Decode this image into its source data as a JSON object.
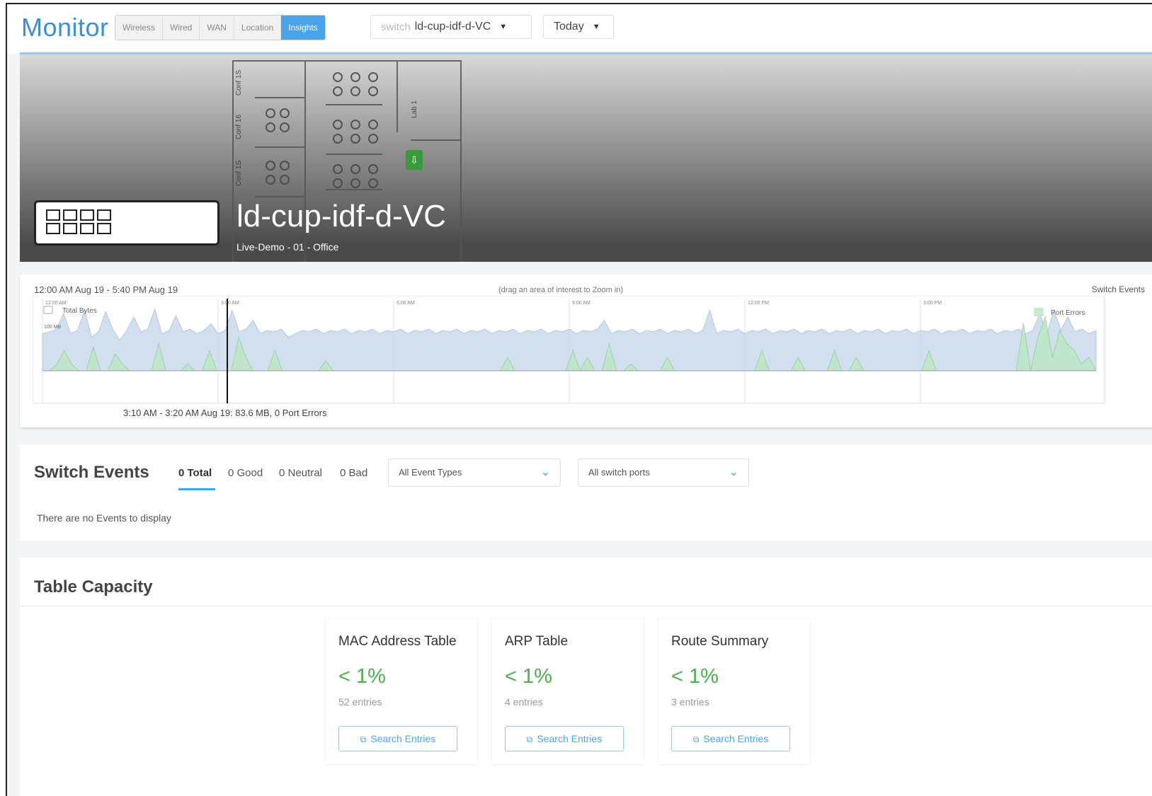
{
  "header": {
    "title": "Monitor",
    "tabs": [
      {
        "label": "Wireless",
        "active": false
      },
      {
        "label": "Wired",
        "active": false
      },
      {
        "label": "WAN",
        "active": false
      },
      {
        "label": "Location",
        "active": false
      },
      {
        "label": "Insights",
        "active": true
      }
    ],
    "switch_dropdown": {
      "prefix": "switch",
      "value": "ld-cup-idf-d-VC"
    },
    "date_dropdown": {
      "value": "Today"
    }
  },
  "hero": {
    "device_name": "ld-cup-idf-d-VC",
    "location": "Live-Demo - 01 - Office",
    "room_labels": [
      "Conf 1S",
      "Conf 16",
      "Conf 1S",
      "Lab 1"
    ]
  },
  "timeline": {
    "range": "12:00 AM Aug 19 - 5:40 PM Aug 19",
    "hint": "(drag an area of interest to Zoom in)",
    "right_label": "Switch Events",
    "hover_readout": "3:10 AM - 3:20 AM Aug 19: 83.6 MB, 0 Port Errors"
  },
  "chart_data": {
    "type": "area",
    "x": [
      "12:00 AM",
      "3:00 AM",
      "6:00 AM",
      "9:00 AM",
      "12:00 PM",
      "3:00 PM"
    ],
    "series": [
      {
        "name": "Total Bytes",
        "color": "#c9d9ec"
      },
      {
        "name": "Port Errors",
        "color": "#bde5c5"
      }
    ],
    "y_tick_labels": [
      "100 MB"
    ],
    "selected_interval": "3:10 AM - 3:20 AM Aug 19",
    "selected_total_bytes_mb": 83.6,
    "selected_port_errors": 0,
    "bytes_profile": [
      0.55,
      0.58,
      0.62,
      0.85,
      0.55,
      0.6,
      0.9,
      0.5,
      0.58,
      0.88,
      0.62,
      0.45,
      0.6,
      0.8,
      0.58,
      0.62,
      0.92,
      0.55,
      0.6,
      0.82,
      0.58,
      0.62,
      0.55,
      0.6,
      0.7,
      0.55,
      0.6,
      0.9,
      0.58,
      0.62,
      0.75,
      0.55,
      0.6,
      0.58,
      0.62,
      0.5,
      0.55,
      0.6,
      0.58,
      0.62,
      0.55,
      0.6,
      0.58,
      0.62,
      0.55,
      0.6,
      0.58,
      0.62,
      0.55,
      0.6,
      0.58,
      0.62,
      0.55,
      0.6,
      0.58,
      0.62,
      0.55,
      0.6,
      0.58,
      0.62,
      0.55,
      0.6,
      0.58,
      0.62,
      0.55,
      0.6,
      0.58,
      0.62,
      0.55,
      0.6,
      0.58,
      0.62,
      0.55,
      0.6,
      0.58,
      0.62,
      0.55,
      0.6,
      0.58,
      0.62,
      0.75,
      0.55,
      0.6,
      0.58,
      0.62,
      0.55,
      0.6,
      0.58,
      0.62,
      0.55,
      0.6,
      0.58,
      0.62,
      0.55,
      0.6,
      0.9,
      0.55,
      0.6,
      0.58,
      0.62,
      0.55,
      0.6,
      0.58,
      0.62,
      0.55,
      0.6,
      0.58,
      0.62,
      0.55,
      0.6,
      0.58,
      0.62,
      0.55,
      0.6,
      0.58,
      0.62,
      0.55,
      0.6,
      0.58,
      0.62,
      0.55,
      0.6,
      0.58,
      0.62,
      0.55,
      0.6,
      0.58,
      0.62,
      0.55,
      0.6,
      0.58,
      0.62,
      0.55,
      0.6,
      0.58,
      0.62,
      0.55,
      0.6,
      0.58,
      0.62,
      0.55,
      0.6,
      0.85,
      0.55,
      0.9,
      0.6,
      0.8,
      0.58,
      0.62,
      0.55,
      0.6
    ],
    "errors_profile": [
      0,
      0,
      0.1,
      0.3,
      0.1,
      0,
      0,
      0.35,
      0,
      0,
      0.25,
      0.1,
      0,
      0,
      0,
      0,
      0.4,
      0,
      0,
      0,
      0.1,
      0,
      0,
      0.3,
      0,
      0,
      0,
      0.5,
      0.2,
      0,
      0,
      0,
      0.3,
      0,
      0,
      0,
      0,
      0,
      0,
      0.15,
      0,
      0,
      0,
      0,
      0,
      0,
      0,
      0,
      0,
      0,
      0,
      0,
      0,
      0,
      0,
      0,
      0,
      0,
      0,
      0,
      0,
      0,
      0,
      0,
      0.2,
      0,
      0,
      0,
      0,
      0,
      0,
      0,
      0,
      0.3,
      0,
      0.2,
      0,
      0,
      0.4,
      0,
      0,
      0.1,
      0,
      0,
      0,
      0,
      0.2,
      0,
      0,
      0,
      0,
      0,
      0,
      0,
      0,
      0,
      0,
      0,
      0,
      0.3,
      0,
      0,
      0,
      0,
      0.2,
      0,
      0,
      0,
      0,
      0.3,
      0,
      0,
      0.2,
      0,
      0,
      0,
      0,
      0,
      0,
      0,
      0,
      0,
      0.3,
      0,
      0,
      0,
      0,
      0,
      0,
      0,
      0,
      0,
      0,
      0,
      0,
      0.7,
      0,
      0.5,
      0.8,
      0.2,
      0.6,
      0.4,
      0.3,
      0.1,
      0.2,
      0
    ]
  },
  "events": {
    "title": "Switch Events",
    "counts": [
      {
        "label": "0 Total",
        "active": true
      },
      {
        "label": "0 Good",
        "active": false
      },
      {
        "label": "0 Neutral",
        "active": false
      },
      {
        "label": "0 Bad",
        "active": false
      }
    ],
    "event_type_select": "All Event Types",
    "port_select": "All switch ports",
    "empty_text": "There are no Events to display"
  },
  "capacity": {
    "title": "Table Capacity",
    "cards": [
      {
        "name": "MAC Address Table",
        "pct": "< 1%",
        "entries": "52 entries",
        "button": "Search Entries"
      },
      {
        "name": "ARP Table",
        "pct": "< 1%",
        "entries": "4 entries",
        "button": "Search Entries"
      },
      {
        "name": "Route Summary",
        "pct": "< 1%",
        "entries": "3 entries",
        "button": "Search Entries"
      }
    ]
  }
}
